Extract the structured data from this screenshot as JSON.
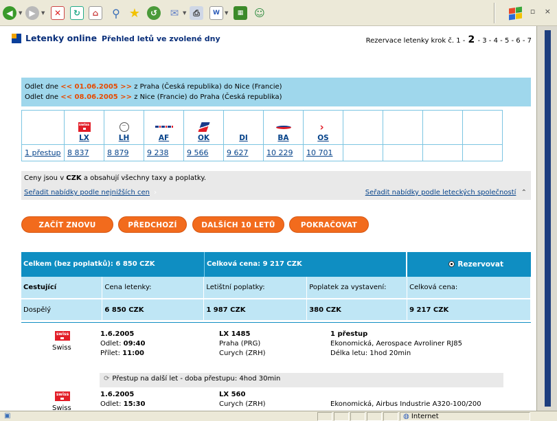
{
  "browser": {
    "status_internet": "Internet"
  },
  "header": {
    "title": "Letenky online",
    "subtitle": "Přehled letů ve zvolené dny",
    "steps_prefix": "Rezervace letenky krok č.",
    "steps": [
      "1",
      "2",
      "3",
      "4",
      "5",
      "6",
      "7"
    ],
    "active_step": "2"
  },
  "route": {
    "line1": {
      "pre": "Odlet dne ",
      "date": "<< 01.06.2005 >>",
      "post": " z Praha (Česká republika) do Nice (Francie)"
    },
    "line2": {
      "pre": "Odlet dne ",
      "date": "<< 08.06.2005 >>",
      "post": " z Nice (Francie) do Praha (Česká republika)"
    }
  },
  "airlines": [
    {
      "code": "",
      "icon": "empty",
      "price": "1 přestup"
    },
    {
      "code": "LX",
      "icon": "swiss-logo-icon",
      "price": "8 837"
    },
    {
      "code": "LH",
      "icon": "lufthansa-crane-icon",
      "price": "8 879"
    },
    {
      "code": "AF",
      "icon": "air-france-icon",
      "price": "9 238"
    },
    {
      "code": "OK",
      "icon": "czech-airlines-icon",
      "price": "9 566"
    },
    {
      "code": "DI",
      "icon": "empty",
      "price": "9 627"
    },
    {
      "code": "BA",
      "icon": "british-airways-icon",
      "price": "10 229"
    },
    {
      "code": "OS",
      "icon": "austrian-arrow-icon",
      "price": "10 701"
    },
    {
      "code": "",
      "icon": "empty",
      "price": ""
    },
    {
      "code": "",
      "icon": "empty",
      "price": ""
    },
    {
      "code": "",
      "icon": "empty",
      "price": ""
    },
    {
      "code": "",
      "icon": "empty",
      "price": ""
    }
  ],
  "note": {
    "pre": "Ceny jsou v ",
    "currency": "CZK",
    "post": " a obsahují všechny taxy a poplatky."
  },
  "sort": {
    "by_price": "Seřadit nabídky podle nejnižších cen",
    "by_airline": "Seřadit nabídky podle leteckých společností"
  },
  "buttons": {
    "restart": "ZAČÍT ZNOVU",
    "previous": "PŘEDCHOZÍ",
    "next10": "DALŠÍCH 10 LETŮ",
    "continue": "POKRAČOVAT"
  },
  "summary": {
    "total_no_fees": "Celkem (bez poplatků): 6 850 CZK",
    "total_price": "Celková cena: 9 217 CZK",
    "reserve": "Rezervovat"
  },
  "price_table": {
    "headers": [
      "Cestující",
      "Cena letenky:",
      "Letištní poplatky:",
      "Poplatek za vystavení:",
      "Celková cena:"
    ],
    "row": [
      "Dospělý",
      "6 850 CZK",
      "1 987 CZK",
      "380 CZK",
      "9 217 CZK"
    ]
  },
  "segment1": {
    "airline": "Swiss",
    "date": "1.6.2005",
    "depart_label": "Odlet: ",
    "depart_time": "09:40",
    "arrive_label": "Přílet: ",
    "arrive_time": "11:00",
    "flight": "LX 1485",
    "from": "Praha (PRG)",
    "to": "Curych (ZRH)",
    "stops": "1 přestup",
    "class": "Ekonomická, Aerospace Avroliner RJ85",
    "duration": "Délka letu: 1hod 20min"
  },
  "transfer": "Přestup na další let - doba přestupu: 4hod 30min",
  "segment2": {
    "airline": "Swiss",
    "date": "1.6.2005",
    "depart_label": "Odlet: ",
    "depart_time": "15:30",
    "flight": "LX 560",
    "from": "Curych (ZRH)",
    "class": "Ekonomická, Airbus Industrie A320-100/200"
  },
  "colors": {
    "accent": "#f26b1d",
    "header_blue": "#0f8ec2",
    "light_blue": "#bfe6f5",
    "route_blue": "#9fd7ec",
    "link": "#06438a"
  }
}
